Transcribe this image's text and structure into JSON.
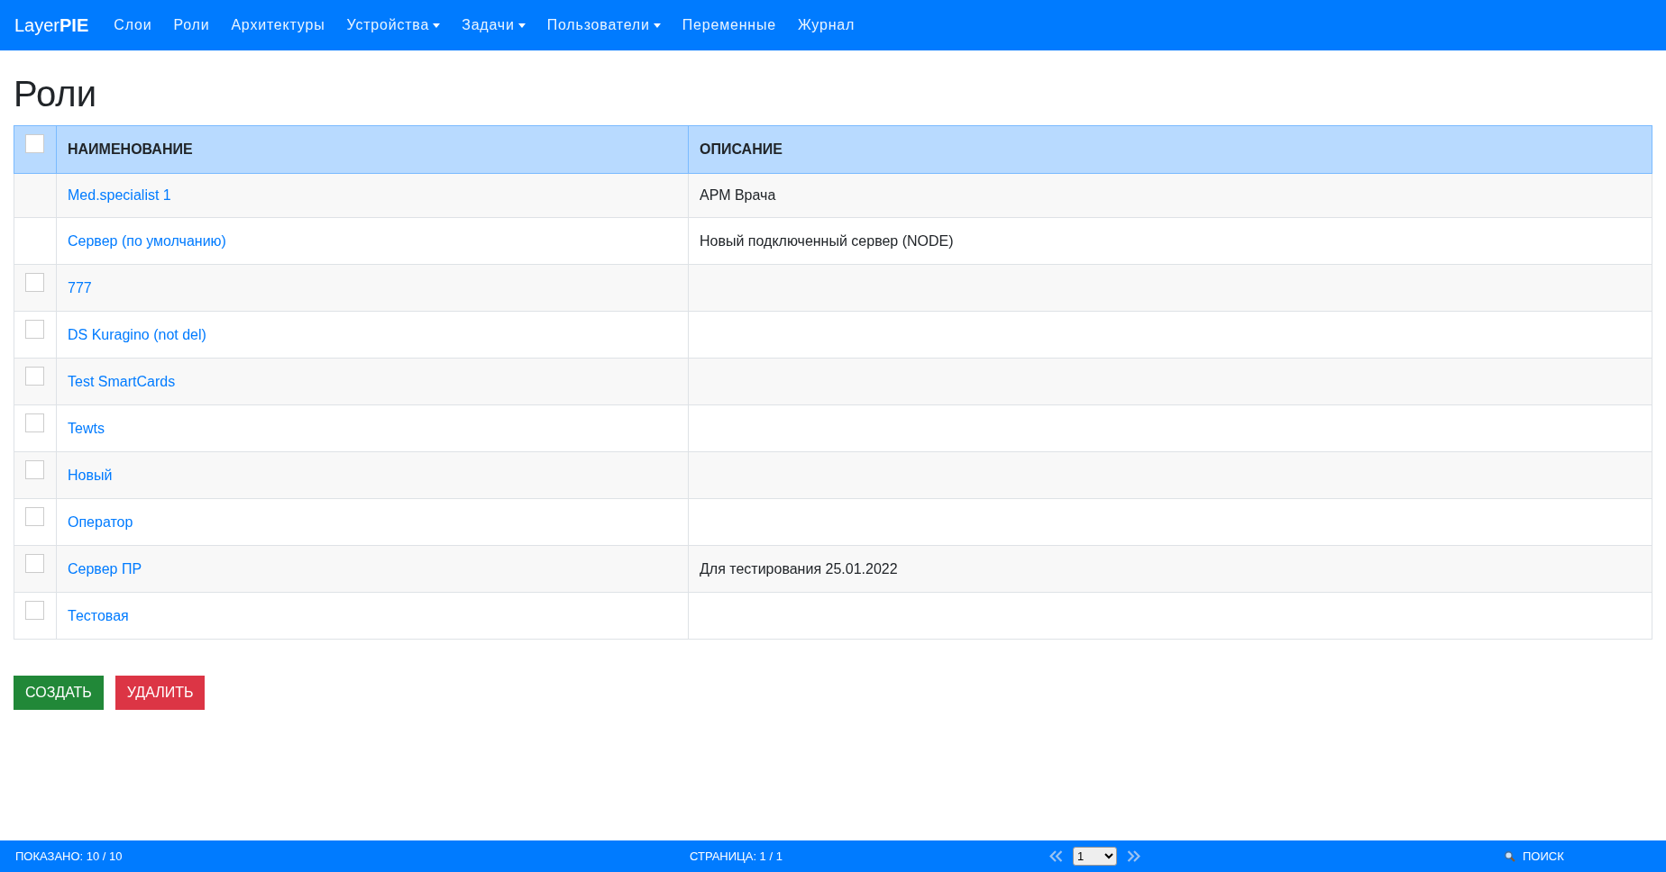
{
  "navbar": {
    "brand_plain": "Layer",
    "brand_bold": "PIE",
    "items": [
      {
        "label": "Слои",
        "dropdown": false
      },
      {
        "label": "Роли",
        "dropdown": false
      },
      {
        "label": "Архитектуры",
        "dropdown": false
      },
      {
        "label": "Устройства",
        "dropdown": true
      },
      {
        "label": "Задачи",
        "dropdown": true
      },
      {
        "label": "Пользователи",
        "dropdown": true
      },
      {
        "label": "Переменные",
        "dropdown": false
      },
      {
        "label": "Журнал",
        "dropdown": false
      }
    ]
  },
  "page_title": "Роли",
  "table": {
    "header_checked": false,
    "columns": [
      "НАИМЕНОВАНИЕ",
      "ОПИСАНИЕ"
    ],
    "rows": [
      {
        "kind": "locked",
        "name": "Med.specialist 1",
        "description": "АРМ Врача"
      },
      {
        "kind": "locked",
        "name": "Сервер (по умолчанию)",
        "description": "Новый подключенный сервер (NODE)"
      },
      {
        "kind": "selectable",
        "checked": false,
        "name": "777"
      },
      {
        "kind": "selectable",
        "checked": false,
        "name": "DS Kuragino (not del)"
      },
      {
        "kind": "selectable",
        "checked": false,
        "name": "Test SmartCards"
      },
      {
        "kind": "selectable",
        "checked": false,
        "name": "Tewts"
      },
      {
        "kind": "selectable",
        "checked": false,
        "name": "Новый"
      },
      {
        "kind": "selectable",
        "checked": false,
        "name": "Оператор"
      },
      {
        "kind": "selectable",
        "checked": false,
        "name": "Сервер ПР",
        "description": "Для тестирования 25.01.2022"
      },
      {
        "kind": "selectable",
        "checked": false,
        "name": "Тестовая"
      }
    ]
  },
  "buttons": [
    {
      "kind": "create",
      "label": "СОЗДАТЬ"
    },
    {
      "kind": "delete",
      "label": "УДАЛИТЬ"
    }
  ],
  "status_bar": {
    "shown": "ПОКАЗАНО: 10 / 10",
    "page": "СТРАНИЦА: 1 / 1",
    "page_select": "1",
    "search": "ПОИСК"
  }
}
